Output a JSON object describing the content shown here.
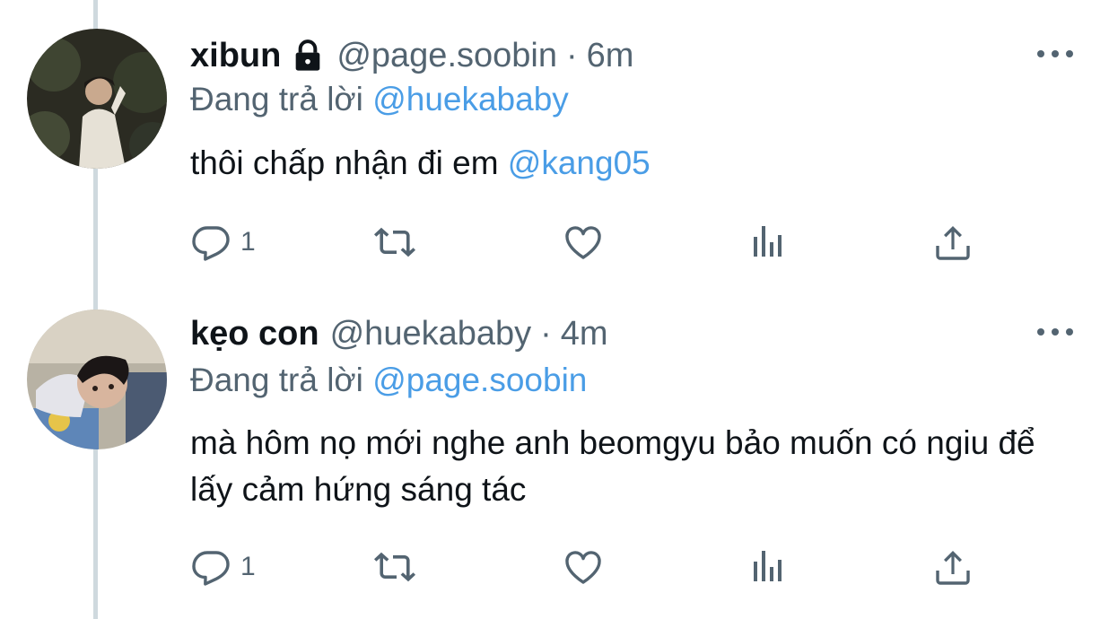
{
  "colors": {
    "text_primary": "#0f1419",
    "text_secondary": "#536471",
    "mention": "#4a9de6",
    "thread_line": "#cfd9de"
  },
  "tweets": [
    {
      "display_name": "xibun",
      "protected_icon": "lock-icon",
      "handle": "@page.soobin",
      "separator": "·",
      "time": "6m",
      "reply_prefix": "Đang trả lời",
      "reply_to": "@huekababy",
      "text": "thôi chấp nhận đi em",
      "text_mention": "@kang05",
      "reply_count": "1"
    },
    {
      "display_name": "kẹo con",
      "handle": "@huekababy",
      "separator": "·",
      "time": "4m",
      "reply_prefix": "Đang trả lời",
      "reply_to": "@page.soobin",
      "text": "mà hôm nọ mới nghe anh beomgyu bảo muốn có ngiu để lấy cảm hứng sáng tác",
      "reply_count": "1"
    }
  ]
}
